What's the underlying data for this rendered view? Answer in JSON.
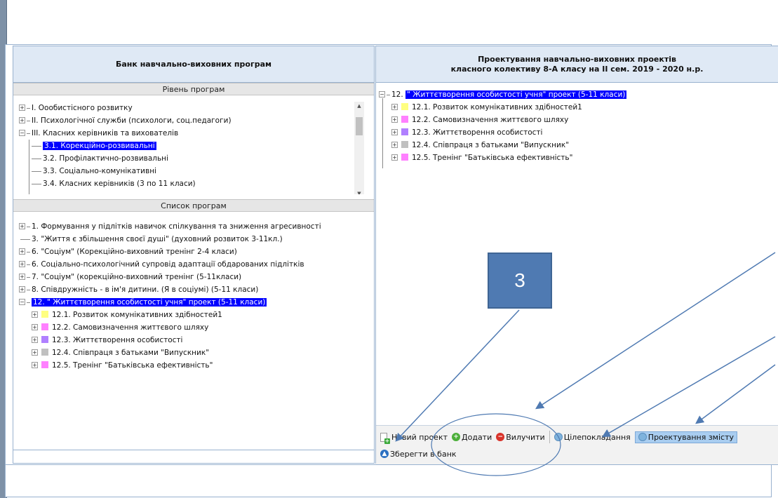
{
  "left_panel": {
    "title": "Банк навчально-виховних програм",
    "levels_title": "Рівень програм",
    "levels": [
      {
        "label": "I. Оообистісного розвитку",
        "expander": "+"
      },
      {
        "label": "II. Психологічної служби (психологи, соц.педагоги)",
        "expander": "+"
      },
      {
        "label": "III. Класних керівників та вихователів",
        "expander": "−"
      },
      {
        "label": "3.1. Корекційно-розвивальні",
        "selected": true
      },
      {
        "label": "3.2. Профілактично-розвивальні"
      },
      {
        "label": "3.3. Соціально-комунікативні"
      },
      {
        "label": "3.4. Класних керівників (3 по 11 класи)"
      }
    ],
    "programs_title": "Список програм",
    "programs": [
      {
        "label": "1. Формування у підлітків навичок спілкування та зниження  агресивності",
        "expander": "+"
      },
      {
        "label": "3. \"Життя є збільшення своєї душі\" (духовний розвиток 3-11кл.)",
        "expander": ""
      },
      {
        "label": "6. \"Соціум\" (Корекційно-виховний тренінг 2-4 класи)",
        "expander": "+"
      },
      {
        "label": "6.  Соціально-психологічний супровід адаптації обдарованих підлітків",
        "expander": "+"
      },
      {
        "label": "7. \"Соціум\" (корекційно-виховний тренінг (5-11класи)",
        "expander": "+"
      },
      {
        "label": "8. Співдружність - в ім'я дитини. (Я в соціумі) (5-11 класи)",
        "expander": "+"
      },
      {
        "label": "12. \" Життєтворення особистості учня\" проект (5-11 класи)",
        "expander": "−",
        "selected": true
      }
    ],
    "subitems": [
      {
        "label": "12.1. Розвиток комунікативних здібностей1",
        "color": "#ffff80"
      },
      {
        "label": "12.2. Самовизначення життєвого шляху",
        "color": "#ff80ff"
      },
      {
        "label": "12.3. Життєтворення особистості",
        "color": "#b080ff"
      },
      {
        "label": "12.4. Співпраця з батьками \"Випускник\"",
        "color": "#c0c0c0"
      },
      {
        "label": "12.5. Тренінг \"Батьківська ефективність\"",
        "color": "#ff80ff"
      }
    ]
  },
  "right_panel": {
    "title_line1": "Проектування навчально-виховних проектів",
    "title_line2": "класного колективу 8-А класу на II сем. 2019 - 2020 н.р.",
    "root_number": "12.",
    "root_label": "\" Життєтворення особистості учня\" проект (5-11 класи)",
    "subitems": [
      {
        "label": "12.1. Розвиток комунікативних здібностей1",
        "color": "#ffff80"
      },
      {
        "label": "12.2. Самовизначення життєвого шляху",
        "color": "#ff80ff"
      },
      {
        "label": "12.3. Життєтворення особистості",
        "color": "#b080ff"
      },
      {
        "label": "12.4. Співпраця з батьками \"Випускник\"",
        "color": "#c0c0c0"
      },
      {
        "label": "12.5. Тренінг \"Батьківська ефективність\"",
        "color": "#ff80ff"
      }
    ]
  },
  "toolbar": {
    "new_project": "Новий проект",
    "add": "Додати",
    "remove": "Вилучити",
    "goal_setting": "Цілепокладання",
    "design_content": "Проектування змісту",
    "save_to_bank": "Зберегти в банк"
  },
  "callout": {
    "label": "3"
  },
  "colors": {
    "selection": "#0000ff",
    "header_bg": "#dfe9f5",
    "callout": "#4f7ab2"
  }
}
